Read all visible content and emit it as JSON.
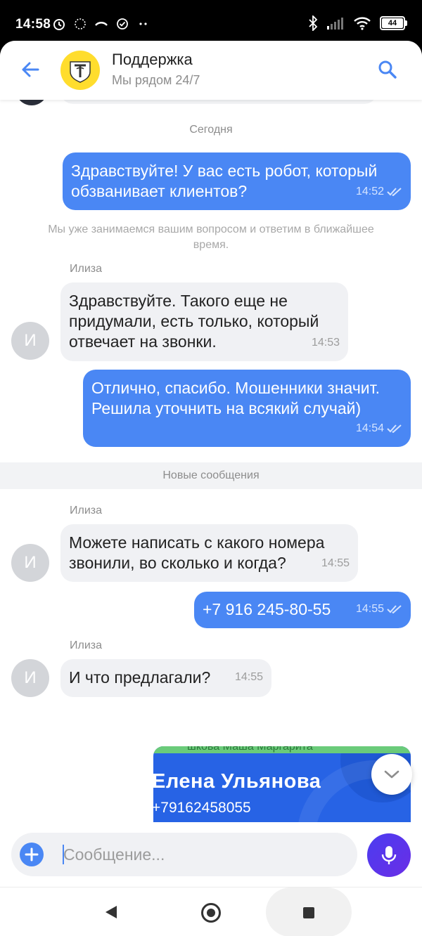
{
  "status_bar": {
    "time": "14:58",
    "battery": "44"
  },
  "header": {
    "title": "Поддержка",
    "subtitle": "Мы рядом 24/7"
  },
  "colors": {
    "accent": "#4a87f4",
    "brand_yellow": "#ffdd2d",
    "mic_gradient": "#5a35eb"
  },
  "chat": {
    "day_separator": "Сегодня",
    "system_note": "Мы уже занимаемся вашим вопросом и ответим в ближайшее время.",
    "new_messages_label": "Новые сообщения",
    "messages": [
      {
        "direction": "out",
        "text": "Здравствуйте! У вас есть робот, который обзванивает клиентов?",
        "time": "14:52",
        "status": "read"
      },
      {
        "direction": "in",
        "sender": "Илиза",
        "avatar_letter": "И",
        "text": "Здравствуйте. Такого еще не придумали, есть только, который отвечает на звонки.",
        "time": "14:53"
      },
      {
        "direction": "out",
        "text": "Отлично, спасибо. Мошенники значит. Решила уточнить на всякий случай)",
        "time": "14:54",
        "status": "read"
      },
      {
        "direction": "in",
        "sender": "Илиза",
        "avatar_letter": "И",
        "text": "Можете написать с какого номера звонили, во сколько и когда?",
        "time": "14:55"
      },
      {
        "direction": "out",
        "text": "+7 916 245-80-55",
        "time": "14:55",
        "status": "read"
      },
      {
        "direction": "in",
        "sender": "Илиза",
        "avatar_letter": "И",
        "text": "И что предлагали?",
        "time": "14:55"
      }
    ],
    "image_message": {
      "top_text": "шкова Маша Маргарита",
      "name": "Елена Ульянова",
      "phone": "+79162458055"
    }
  },
  "composer": {
    "placeholder": "Сообщение..."
  }
}
